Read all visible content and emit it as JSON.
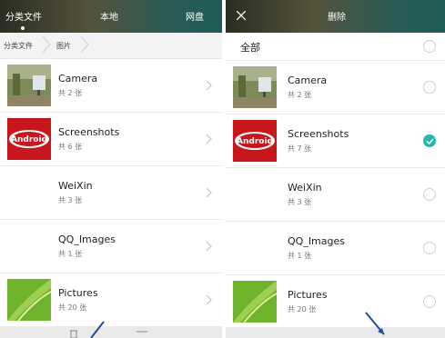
{
  "left": {
    "tabs": [
      "分类文件",
      "本地",
      "网盘"
    ],
    "breadcrumb": [
      "分类文件",
      "图片"
    ],
    "items": [
      {
        "name": "Camera",
        "count": "共 2 张",
        "thumb": "camera-photo-thumbnail"
      },
      {
        "name": "Screenshots",
        "count": "共 6 张",
        "thumb": "android-kitkat-thumbnail"
      },
      {
        "name": "WeiXin",
        "count": "共 3 张",
        "thumb": "blank-thumbnail"
      },
      {
        "name": "QQ_Images",
        "count": "共 1 张",
        "thumb": "blank-thumbnail"
      },
      {
        "name": "Pictures",
        "count": "共 20 张",
        "thumb": "green-leaf-thumbnail"
      }
    ]
  },
  "right": {
    "title": "删除",
    "close_icon": "close-icon",
    "select_all": "全部",
    "items": [
      {
        "name": "Camera",
        "count": "共 2 张",
        "checked": false
      },
      {
        "name": "Screenshots",
        "count": "共 7 张",
        "checked": true
      },
      {
        "name": "WeiXin",
        "count": "共 3 张",
        "checked": false
      },
      {
        "name": "QQ_Images",
        "count": "共 1 张",
        "checked": false
      },
      {
        "name": "Pictures",
        "count": "共 20 张",
        "checked": false
      }
    ]
  },
  "colors": {
    "accent": "#29b6b0",
    "header_dark": "#2a2d22",
    "header_teal": "#1f5d57",
    "annotation_arrow": "#1f4e9a"
  }
}
